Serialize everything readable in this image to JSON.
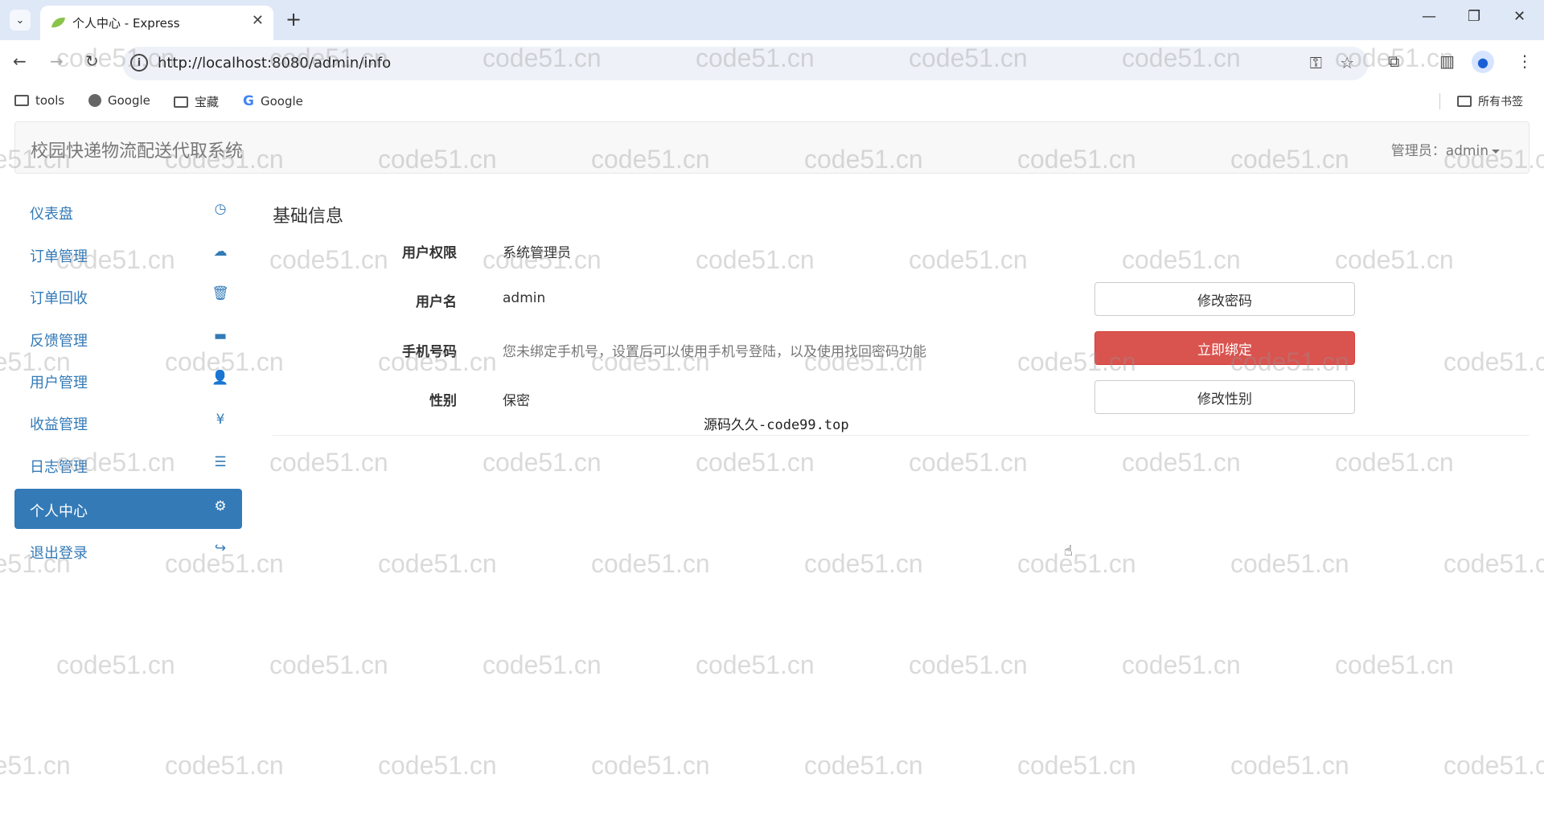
{
  "browser": {
    "tab_title": "个人中心 - Express",
    "url": "http://localhost:8080/admin/info",
    "bookmarks": [
      "tools",
      "Google",
      "宝藏",
      "Google"
    ],
    "all_bookmarks_label": "所有书签"
  },
  "app": {
    "brand": "校园快递物流配送代取系统",
    "admin_label": "管理员：admin"
  },
  "sidebar": {
    "items": [
      {
        "label": "仪表盘",
        "icon": "dashboard-icon"
      },
      {
        "label": "订单管理",
        "icon": "cloud-upload-icon"
      },
      {
        "label": "订单回收",
        "icon": "trash-icon"
      },
      {
        "label": "反馈管理",
        "icon": "comment-icon"
      },
      {
        "label": "用户管理",
        "icon": "user-icon"
      },
      {
        "label": "收益管理",
        "icon": "yen-icon"
      },
      {
        "label": "日志管理",
        "icon": "list-icon"
      },
      {
        "label": "个人中心",
        "icon": "gear-icon",
        "active": true
      },
      {
        "label": "退出登录",
        "icon": "logout-icon"
      }
    ]
  },
  "main": {
    "section_title": "基础信息",
    "rows": [
      {
        "label": "用户权限",
        "value": "系统管理员"
      },
      {
        "label": "用户名",
        "value": "admin",
        "button": "修改密码"
      },
      {
        "label": "手机号码",
        "value": "您未绑定手机号，设置后可以使用手机号登陆，以及使用找回密码功能",
        "button": "立即绑定"
      },
      {
        "label": "性别",
        "value": "保密",
        "button": "修改性别"
      }
    ],
    "footer_note": "源码久久-code99.top"
  },
  "watermark": "code51.cn",
  "colors": {
    "primary": "#337ab7",
    "danger": "#d9534f"
  }
}
